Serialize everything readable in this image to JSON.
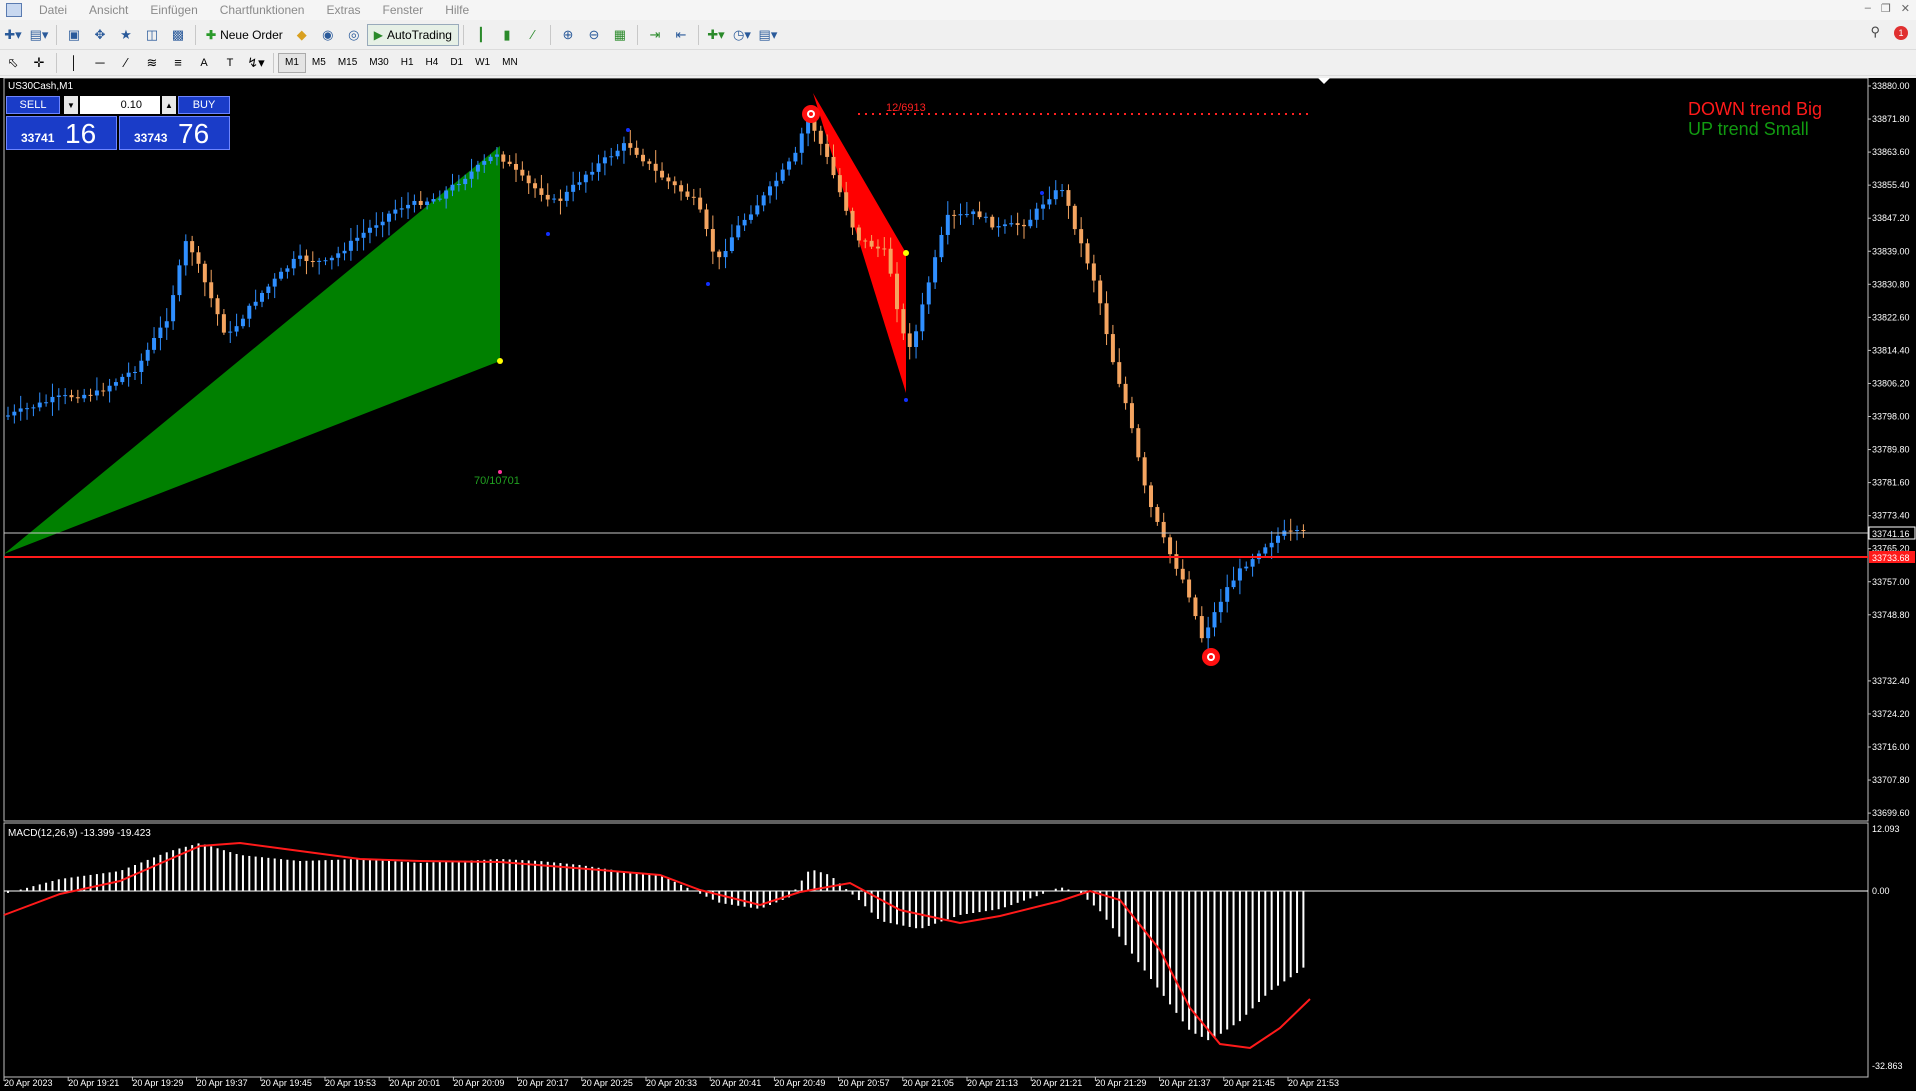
{
  "menu": {
    "items": [
      "Datei",
      "Ansicht",
      "Einfügen",
      "Chartfunktionen",
      "Extras",
      "Fenster",
      "Hilfe"
    ]
  },
  "toolbar": {
    "new_order_label": "Neue Order",
    "autotrading_label": "AutoTrading"
  },
  "timeframes": [
    "M1",
    "M5",
    "M15",
    "M30",
    "H1",
    "H4",
    "D1",
    "W1",
    "MN"
  ],
  "notifications": {
    "count": "1"
  },
  "chart": {
    "symbol": "US30Cash,M1",
    "price_labels": [
      "33880.00",
      "33871.80",
      "33863.60",
      "33855.40",
      "33847.20",
      "33839.00",
      "33830.80",
      "33822.60",
      "33814.40",
      "33806.20",
      "33798.00",
      "33789.80",
      "33781.60",
      "33773.40",
      "33765.20",
      "33757.00",
      "33748.80",
      "33741.16",
      "33732.40",
      "33724.20",
      "33716.00",
      "33707.80",
      "33699.60"
    ],
    "current_price_label": "33741.16",
    "red_line_label": "33733.68",
    "time_labels": [
      "20 Apr 2023",
      "20 Apr 19:21",
      "20 Apr 19:29",
      "20 Apr 19:37",
      "20 Apr 19:45",
      "20 Apr 19:53",
      "20 Apr 20:01",
      "20 Apr 20:09",
      "20 Apr 20:17",
      "20 Apr 20:25",
      "20 Apr 20:33",
      "20 Apr 20:41",
      "20 Apr 20:49",
      "20 Apr 20:57",
      "20 Apr 21:05",
      "20 Apr 21:13",
      "20 Apr 21:21",
      "20 Apr 21:29",
      "20 Apr 21:37",
      "20 Apr 21:45",
      "20 Apr 21:53"
    ],
    "annotation_top": "12/6913",
    "annotation_mid": "70/10701",
    "legend_down": "DOWN trend Big",
    "legend_up": "UP trend Small",
    "colors": {
      "bull": "#2f8fff",
      "bear": "#f4a460",
      "up_zone": "#008000",
      "down_zone": "#ff0000",
      "line": "#ff0000"
    }
  },
  "trade_panel": {
    "sell_label": "SELL",
    "buy_label": "BUY",
    "lot": "0.10",
    "bid_small": "33741",
    "bid_big": "16",
    "ask_small": "33743",
    "ask_big": "76"
  },
  "macd": {
    "label": "MACD(12,26,9) -13.399 -19.423",
    "max_label": "12.093",
    "zero_label": "0.00",
    "min_label": "-32.863"
  }
}
